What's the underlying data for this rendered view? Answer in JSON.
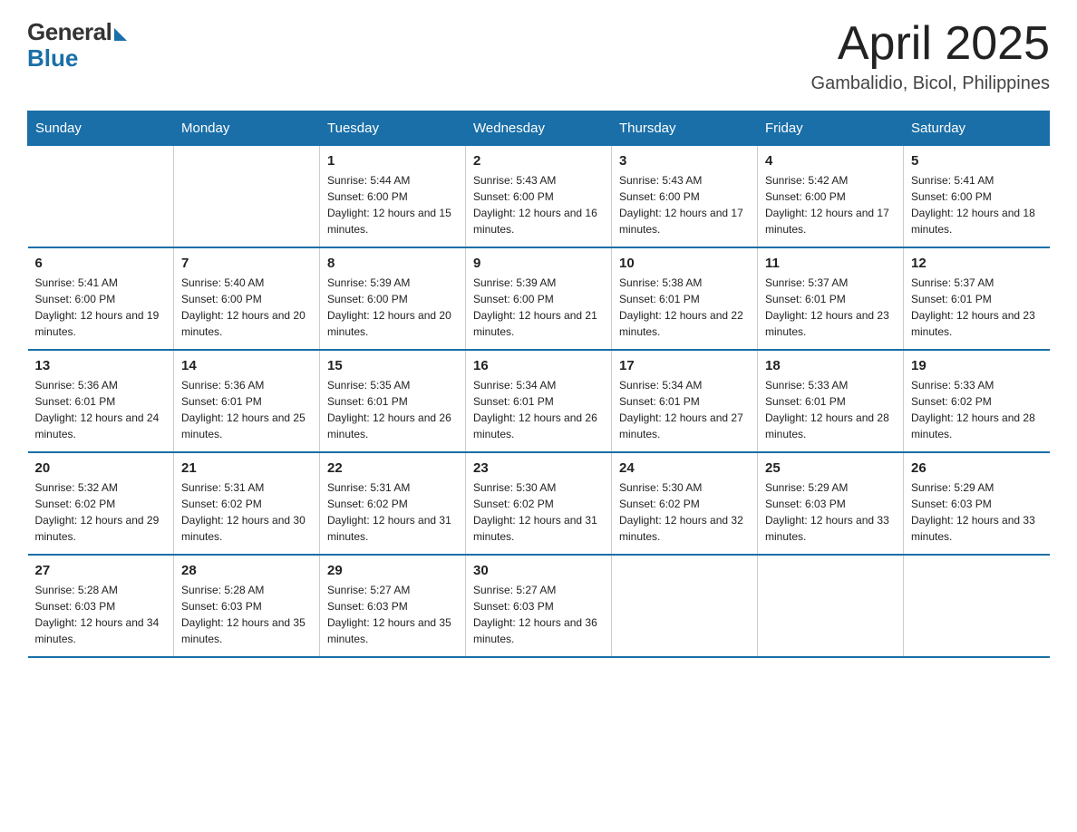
{
  "header": {
    "logo_general": "General",
    "logo_blue": "Blue",
    "month": "April 2025",
    "location": "Gambalidio, Bicol, Philippines"
  },
  "weekdays": [
    "Sunday",
    "Monday",
    "Tuesday",
    "Wednesday",
    "Thursday",
    "Friday",
    "Saturday"
  ],
  "weeks": [
    [
      {
        "day": "",
        "sunrise": "",
        "sunset": "",
        "daylight": ""
      },
      {
        "day": "",
        "sunrise": "",
        "sunset": "",
        "daylight": ""
      },
      {
        "day": "1",
        "sunrise": "Sunrise: 5:44 AM",
        "sunset": "Sunset: 6:00 PM",
        "daylight": "Daylight: 12 hours and 15 minutes."
      },
      {
        "day": "2",
        "sunrise": "Sunrise: 5:43 AM",
        "sunset": "Sunset: 6:00 PM",
        "daylight": "Daylight: 12 hours and 16 minutes."
      },
      {
        "day": "3",
        "sunrise": "Sunrise: 5:43 AM",
        "sunset": "Sunset: 6:00 PM",
        "daylight": "Daylight: 12 hours and 17 minutes."
      },
      {
        "day": "4",
        "sunrise": "Sunrise: 5:42 AM",
        "sunset": "Sunset: 6:00 PM",
        "daylight": "Daylight: 12 hours and 17 minutes."
      },
      {
        "day": "5",
        "sunrise": "Sunrise: 5:41 AM",
        "sunset": "Sunset: 6:00 PM",
        "daylight": "Daylight: 12 hours and 18 minutes."
      }
    ],
    [
      {
        "day": "6",
        "sunrise": "Sunrise: 5:41 AM",
        "sunset": "Sunset: 6:00 PM",
        "daylight": "Daylight: 12 hours and 19 minutes."
      },
      {
        "day": "7",
        "sunrise": "Sunrise: 5:40 AM",
        "sunset": "Sunset: 6:00 PM",
        "daylight": "Daylight: 12 hours and 20 minutes."
      },
      {
        "day": "8",
        "sunrise": "Sunrise: 5:39 AM",
        "sunset": "Sunset: 6:00 PM",
        "daylight": "Daylight: 12 hours and 20 minutes."
      },
      {
        "day": "9",
        "sunrise": "Sunrise: 5:39 AM",
        "sunset": "Sunset: 6:00 PM",
        "daylight": "Daylight: 12 hours and 21 minutes."
      },
      {
        "day": "10",
        "sunrise": "Sunrise: 5:38 AM",
        "sunset": "Sunset: 6:01 PM",
        "daylight": "Daylight: 12 hours and 22 minutes."
      },
      {
        "day": "11",
        "sunrise": "Sunrise: 5:37 AM",
        "sunset": "Sunset: 6:01 PM",
        "daylight": "Daylight: 12 hours and 23 minutes."
      },
      {
        "day": "12",
        "sunrise": "Sunrise: 5:37 AM",
        "sunset": "Sunset: 6:01 PM",
        "daylight": "Daylight: 12 hours and 23 minutes."
      }
    ],
    [
      {
        "day": "13",
        "sunrise": "Sunrise: 5:36 AM",
        "sunset": "Sunset: 6:01 PM",
        "daylight": "Daylight: 12 hours and 24 minutes."
      },
      {
        "day": "14",
        "sunrise": "Sunrise: 5:36 AM",
        "sunset": "Sunset: 6:01 PM",
        "daylight": "Daylight: 12 hours and 25 minutes."
      },
      {
        "day": "15",
        "sunrise": "Sunrise: 5:35 AM",
        "sunset": "Sunset: 6:01 PM",
        "daylight": "Daylight: 12 hours and 26 minutes."
      },
      {
        "day": "16",
        "sunrise": "Sunrise: 5:34 AM",
        "sunset": "Sunset: 6:01 PM",
        "daylight": "Daylight: 12 hours and 26 minutes."
      },
      {
        "day": "17",
        "sunrise": "Sunrise: 5:34 AM",
        "sunset": "Sunset: 6:01 PM",
        "daylight": "Daylight: 12 hours and 27 minutes."
      },
      {
        "day": "18",
        "sunrise": "Sunrise: 5:33 AM",
        "sunset": "Sunset: 6:01 PM",
        "daylight": "Daylight: 12 hours and 28 minutes."
      },
      {
        "day": "19",
        "sunrise": "Sunrise: 5:33 AM",
        "sunset": "Sunset: 6:02 PM",
        "daylight": "Daylight: 12 hours and 28 minutes."
      }
    ],
    [
      {
        "day": "20",
        "sunrise": "Sunrise: 5:32 AM",
        "sunset": "Sunset: 6:02 PM",
        "daylight": "Daylight: 12 hours and 29 minutes."
      },
      {
        "day": "21",
        "sunrise": "Sunrise: 5:31 AM",
        "sunset": "Sunset: 6:02 PM",
        "daylight": "Daylight: 12 hours and 30 minutes."
      },
      {
        "day": "22",
        "sunrise": "Sunrise: 5:31 AM",
        "sunset": "Sunset: 6:02 PM",
        "daylight": "Daylight: 12 hours and 31 minutes."
      },
      {
        "day": "23",
        "sunrise": "Sunrise: 5:30 AM",
        "sunset": "Sunset: 6:02 PM",
        "daylight": "Daylight: 12 hours and 31 minutes."
      },
      {
        "day": "24",
        "sunrise": "Sunrise: 5:30 AM",
        "sunset": "Sunset: 6:02 PM",
        "daylight": "Daylight: 12 hours and 32 minutes."
      },
      {
        "day": "25",
        "sunrise": "Sunrise: 5:29 AM",
        "sunset": "Sunset: 6:03 PM",
        "daylight": "Daylight: 12 hours and 33 minutes."
      },
      {
        "day": "26",
        "sunrise": "Sunrise: 5:29 AM",
        "sunset": "Sunset: 6:03 PM",
        "daylight": "Daylight: 12 hours and 33 minutes."
      }
    ],
    [
      {
        "day": "27",
        "sunrise": "Sunrise: 5:28 AM",
        "sunset": "Sunset: 6:03 PM",
        "daylight": "Daylight: 12 hours and 34 minutes."
      },
      {
        "day": "28",
        "sunrise": "Sunrise: 5:28 AM",
        "sunset": "Sunset: 6:03 PM",
        "daylight": "Daylight: 12 hours and 35 minutes."
      },
      {
        "day": "29",
        "sunrise": "Sunrise: 5:27 AM",
        "sunset": "Sunset: 6:03 PM",
        "daylight": "Daylight: 12 hours and 35 minutes."
      },
      {
        "day": "30",
        "sunrise": "Sunrise: 5:27 AM",
        "sunset": "Sunset: 6:03 PM",
        "daylight": "Daylight: 12 hours and 36 minutes."
      },
      {
        "day": "",
        "sunrise": "",
        "sunset": "",
        "daylight": ""
      },
      {
        "day": "",
        "sunrise": "",
        "sunset": "",
        "daylight": ""
      },
      {
        "day": "",
        "sunrise": "",
        "sunset": "",
        "daylight": ""
      }
    ]
  ]
}
